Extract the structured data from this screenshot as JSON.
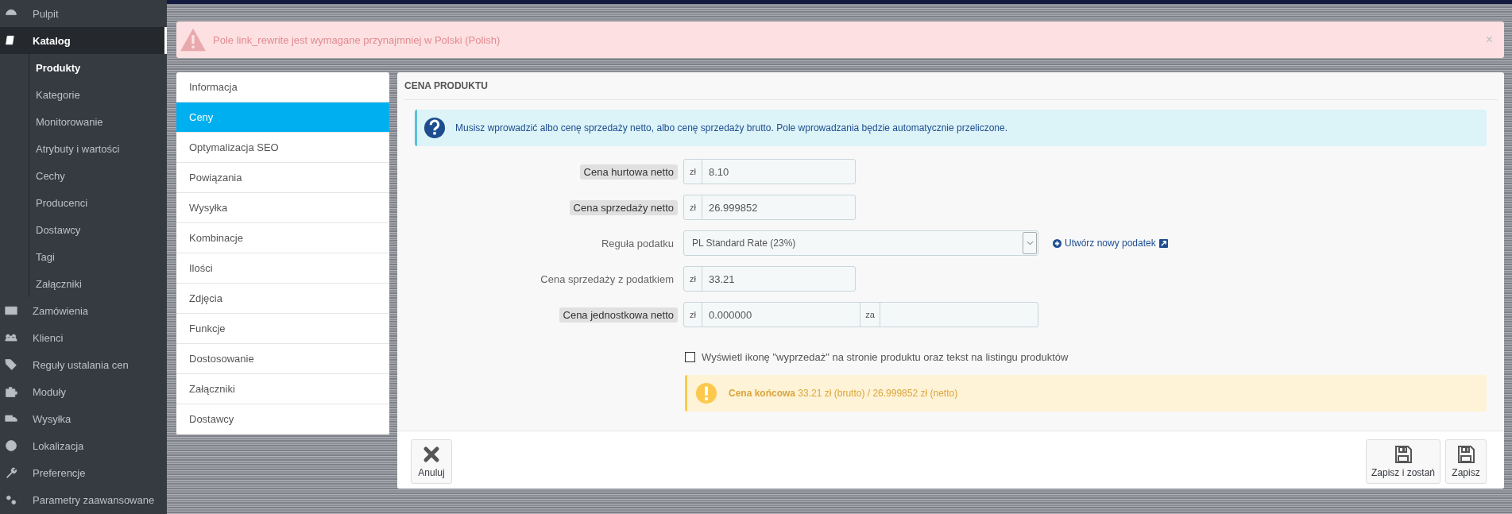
{
  "sidebar": {
    "items": [
      {
        "label": "Pulpit",
        "selected": false
      },
      {
        "label": "Katalog",
        "selected": true,
        "children": [
          {
            "label": "Produkty",
            "selected": true
          },
          {
            "label": "Kategorie",
            "selected": false
          },
          {
            "label": "Monitorowanie",
            "selected": false
          },
          {
            "label": "Atrybuty i wartości",
            "selected": false
          },
          {
            "label": "Cechy",
            "selected": false
          },
          {
            "label": "Producenci",
            "selected": false
          },
          {
            "label": "Dostawcy",
            "selected": false
          },
          {
            "label": "Tagi",
            "selected": false
          },
          {
            "label": "Załączniki",
            "selected": false
          }
        ]
      },
      {
        "label": "Zamówienia",
        "selected": false
      },
      {
        "label": "Klienci",
        "selected": false
      },
      {
        "label": "Reguły ustalania cen",
        "selected": false
      },
      {
        "label": "Moduły",
        "selected": false
      },
      {
        "label": "Wysyłka",
        "selected": false
      },
      {
        "label": "Lokalizacja",
        "selected": false
      },
      {
        "label": "Preferencje",
        "selected": false
      },
      {
        "label": "Parametry zaawansowane",
        "selected": false
      }
    ]
  },
  "error_alert": {
    "message": "Pole link_rewrite jest wymagane przynajmniej w Polski (Polish)",
    "close": "×"
  },
  "tabs": [
    {
      "label": "Informacja",
      "selected": false
    },
    {
      "label": "Ceny",
      "selected": true
    },
    {
      "label": "Optymalizacja SEO",
      "selected": false
    },
    {
      "label": "Powiązania",
      "selected": false
    },
    {
      "label": "Wysyłka",
      "selected": false
    },
    {
      "label": "Kombinacje",
      "selected": false
    },
    {
      "label": "Ilości",
      "selected": false
    },
    {
      "label": "Zdjęcia",
      "selected": false
    },
    {
      "label": "Funkcje",
      "selected": false
    },
    {
      "label": "Dostosowanie",
      "selected": false
    },
    {
      "label": "Załączniki",
      "selected": false
    },
    {
      "label": "Dostawcy",
      "selected": false
    }
  ],
  "panel": {
    "title": "CENA PRODUKTU",
    "info": "Musisz wprowadzić albo cenę sprzedaży netto, albo cenę sprzedaży brutto. Pole wprowadzania będzie automatycznie przeliczone.",
    "fields": [
      {
        "kind": "price",
        "label": "Cena hurtowa netto",
        "highlighted": true,
        "prefix": "zł",
        "value": "8.10"
      },
      {
        "kind": "price",
        "label": "Cena sprzedaży netto",
        "highlighted": true,
        "prefix": "zł",
        "value": "26.999852"
      },
      {
        "kind": "select",
        "label": "Reguła podatku",
        "highlighted": false,
        "value": "PL Standard Rate (23%)",
        "link": "Utwórz nowy podatek"
      },
      {
        "kind": "price",
        "label": "Cena sprzedaży z podatkiem",
        "highlighted": false,
        "prefix": "zł",
        "value": "33.21"
      },
      {
        "kind": "unit",
        "label": "Cena jednostkowa netto",
        "highlighted": true,
        "prefix": "zł",
        "value": "0.000000",
        "suffix": "za"
      }
    ],
    "on_sale": {
      "label": "Wyświetl ikonę \"wyprzedaż\" na stronie produktu oraz tekst na listingu produktów",
      "checked": false
    },
    "final_price": "**Cena końcowa** 33.21 zł (brutto) / 26.999852 zł (netto)",
    "buttons": [
      {
        "label": "Anuluj",
        "kind": "cancel"
      },
      {
        "label": "Zapisz i zostań",
        "kind": "save"
      },
      {
        "label": "Zapisz",
        "kind": "save"
      }
    ]
  }
}
